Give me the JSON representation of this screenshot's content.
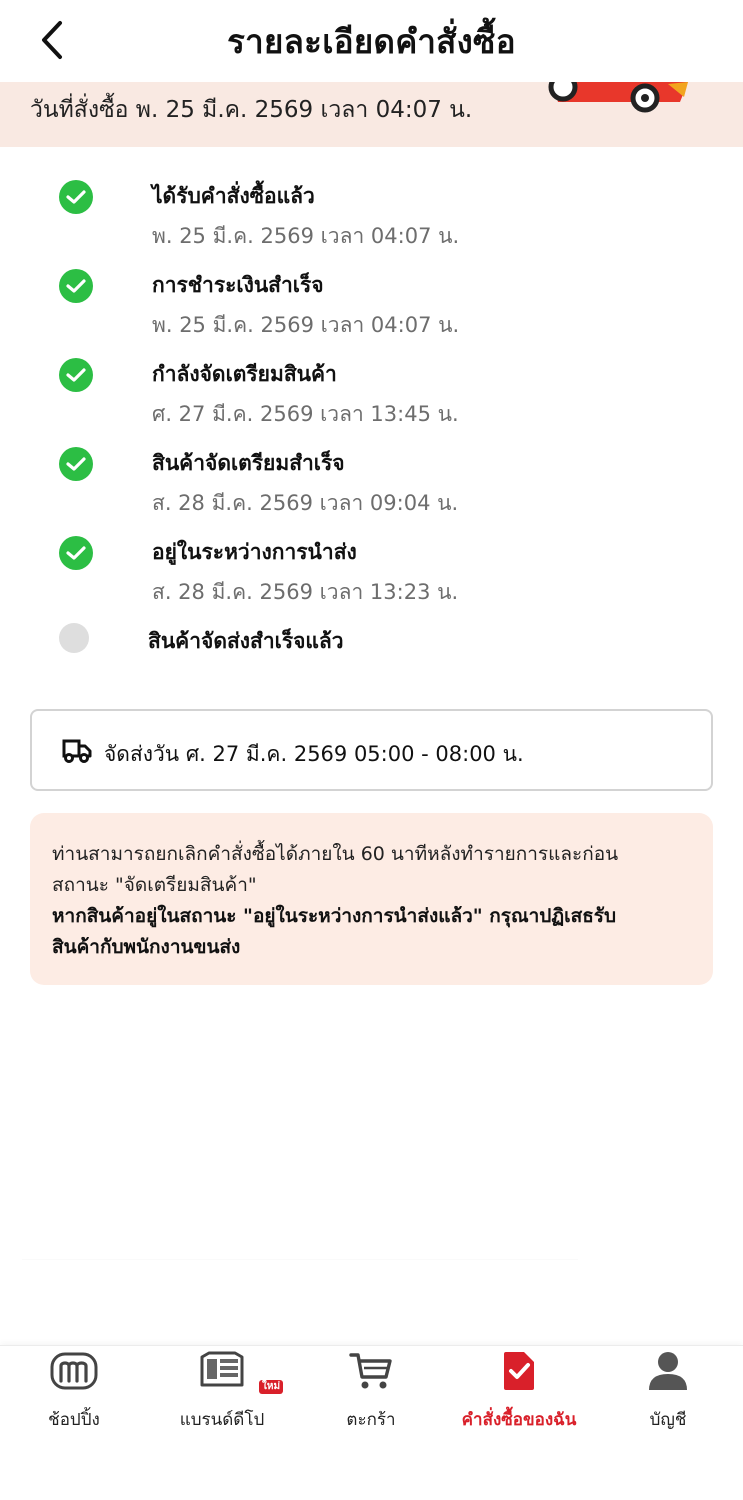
{
  "header": {
    "title": "รายละเอียดคำสั่งซื้อ",
    "back_icon": "chevron-left-icon"
  },
  "banner": {
    "order_date": "วันที่สั่งซื้อ พ. 25 มี.ค. 2569 เวลา 04:07 น."
  },
  "timeline": [
    {
      "title": "ได้รับคำสั่งซื้อแล้ว",
      "time": "พ. 25 มี.ค. 2569 เวลา 04:07 น.",
      "status": "done"
    },
    {
      "title": "การชำระเงินสำเร็จ",
      "time": "พ. 25 มี.ค. 2569 เวลา 04:07 น.",
      "status": "done"
    },
    {
      "title": "กำลังจัดเตรียมสินค้า",
      "time": "ศ. 27 มี.ค. 2569 เวลา 13:45 น.",
      "status": "done"
    },
    {
      "title": "สินค้าจัดเตรียมสำเร็จ",
      "time": "ส. 28 มี.ค. 2569 เวลา 09:04 น.",
      "status": "done"
    },
    {
      "title": "อยู่ในระหว่างการนำส่ง",
      "time": "ส. 28 มี.ค. 2569 เวลา 13:23 น.",
      "status": "done"
    },
    {
      "title": "สินค้าจัดส่งสำเร็จแล้ว",
      "time": "",
      "status": "pending"
    }
  ],
  "delivery": {
    "text": "จัดส่งวัน ศ. 27 มี.ค. 2569 05:00 - 08:00 น.",
    "icon": "delivery-truck-icon"
  },
  "notice": {
    "line1": "ท่านสามารถยกเลิกคำสั่งซื้อได้ภายใน 60 นาทีหลังทำรายการและก่อน",
    "line2": "สถานะ \"จัดเตรียมสินค้า\"",
    "line3": "หากสินค้าอยู่ในสถานะ \"อยู่ในระหว่างการนำส่งแล้ว\" กรุณาปฏิเสธรับ",
    "line4": "สินค้ากับพนักงานขนส่ง"
  },
  "bottom_nav": {
    "items": [
      {
        "label": "ช้อปปิ้ง",
        "icon": "shopping-m-icon",
        "active": false
      },
      {
        "label": "แบรนด์ดีโป",
        "icon": "brand-store-icon",
        "badge": "ใหม่",
        "active": false
      },
      {
        "label": "ตะกร้า",
        "icon": "cart-icon",
        "active": false
      },
      {
        "label": "คำสั่งซื้อของฉัน",
        "icon": "my-orders-icon",
        "active": true
      },
      {
        "label": "บัญชี",
        "icon": "account-icon",
        "active": false
      }
    ]
  },
  "colors": {
    "accent": "#d9202a",
    "done_green": "#2cbe44",
    "banner_bg": "#f9e9e2",
    "notice_bg": "#fdece4",
    "pending_gray": "#dedede"
  }
}
